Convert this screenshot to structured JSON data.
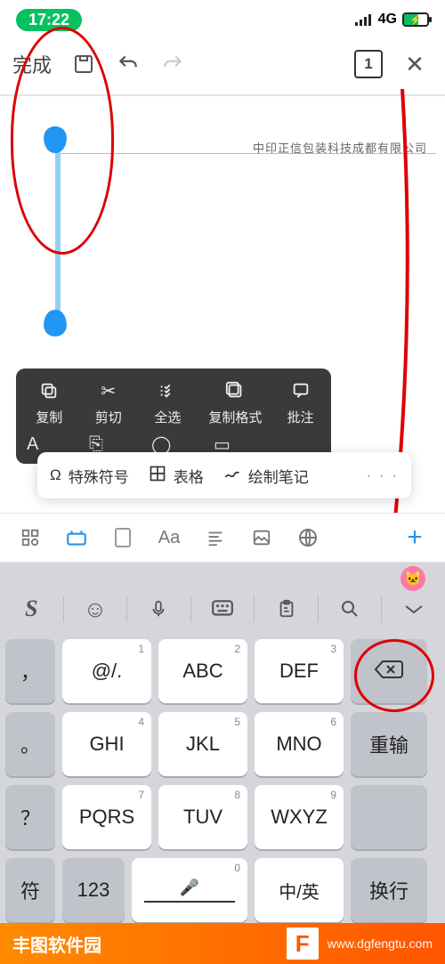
{
  "status": {
    "time": "17:22",
    "net": "4G"
  },
  "toolbar": {
    "done": "完成",
    "page": "1"
  },
  "document": {
    "title": "中印正信包装科技成都有限公司"
  },
  "context_menu": {
    "row1": [
      {
        "label": "复制"
      },
      {
        "label": "剪切"
      },
      {
        "label": "全选"
      },
      {
        "label": "复制格式"
      },
      {
        "label": "批注"
      }
    ]
  },
  "sub_popup": {
    "symbols": "特殊符号",
    "table": "表格",
    "notes": "绘制笔记",
    "more": "· · ·"
  },
  "format_bar": {
    "font_label": "Aa"
  },
  "keyboard": {
    "r1": {
      "k1": "@/.",
      "k2": "ABC",
      "k3": "DEF",
      "n1": "1",
      "n2": "2",
      "n3": "3"
    },
    "r2": {
      "k1": "GHI",
      "k2": "JKL",
      "k3": "MNO",
      "n1": "4",
      "n2": "5",
      "n3": "6",
      "right": "重输"
    },
    "r3": {
      "k1": "PQRS",
      "k2": "TUV",
      "k3": "WXYZ",
      "n1": "7",
      "n2": "8",
      "n3": "9"
    },
    "r4": {
      "left": "符",
      "num": "123",
      "n0": "0",
      "lang": "中/英",
      "enter": "换行"
    },
    "side": {
      "comma": "，",
      "period": "。",
      "q": "？"
    }
  },
  "watermark": {
    "brand": "丰图软件园",
    "url": "www.dgfengtu.com",
    "glyph": "F"
  }
}
